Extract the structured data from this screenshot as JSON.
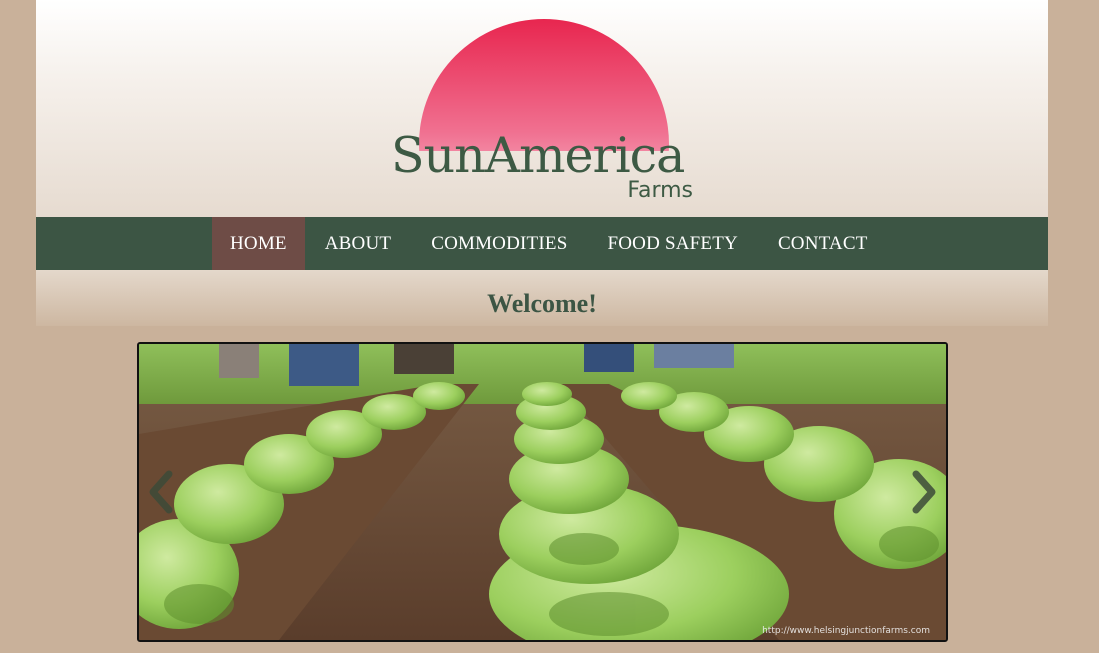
{
  "logo": {
    "name": "SunAmerica",
    "sub": "Farms"
  },
  "nav": {
    "items": [
      {
        "label": "HOME",
        "active": true
      },
      {
        "label": "ABOUT",
        "active": false
      },
      {
        "label": "COMMODITIES",
        "active": false
      },
      {
        "label": "FOOD SAFETY",
        "active": false
      },
      {
        "label": "CONTACT",
        "active": false
      }
    ]
  },
  "welcome": {
    "heading": "Welcome!"
  },
  "carousel": {
    "image_subject": "workers planting rows of leafy green crops in a field",
    "credit": "http://www.helsingjunctionfarms.com",
    "prev_icon": "chevron-left-icon",
    "next_icon": "chevron-right-icon"
  },
  "colors": {
    "background": "#c9b19a",
    "nav": "#3c5544",
    "nav_active": "#6e4c46",
    "brand_green": "#3d5a44",
    "sun_red": "#e8264f"
  }
}
